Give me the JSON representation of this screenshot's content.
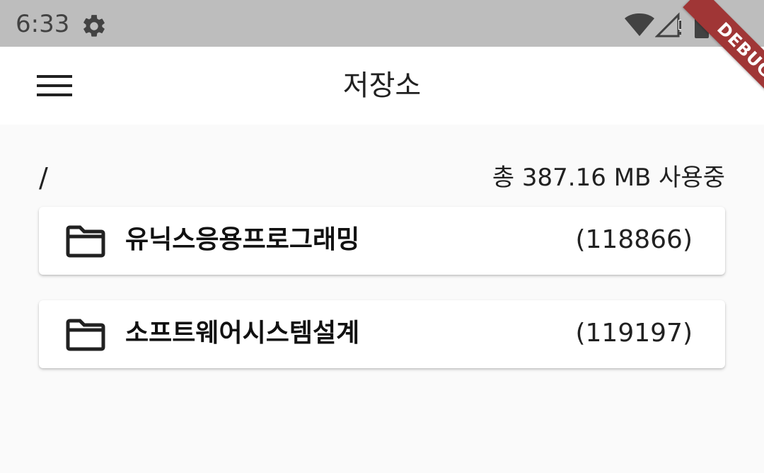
{
  "status_bar": {
    "time": "6:33",
    "icons": [
      "gear-icon",
      "wifi-icon",
      "signal-icon",
      "battery-icon"
    ]
  },
  "debug_banner": {
    "label": "DEBUG",
    "color": "#a03636"
  },
  "app_bar": {
    "menu_icon": "menu-icon",
    "title": "저장소"
  },
  "storage": {
    "path": "/",
    "usage": "총 387.16 MB 사용중"
  },
  "folders": [
    {
      "icon": "folder-icon",
      "name": "유닉스응용프로그래밍",
      "count": "(118866)"
    },
    {
      "icon": "folder-icon",
      "name": "소프트웨어시스템설계",
      "count": "(119197)"
    }
  ]
}
